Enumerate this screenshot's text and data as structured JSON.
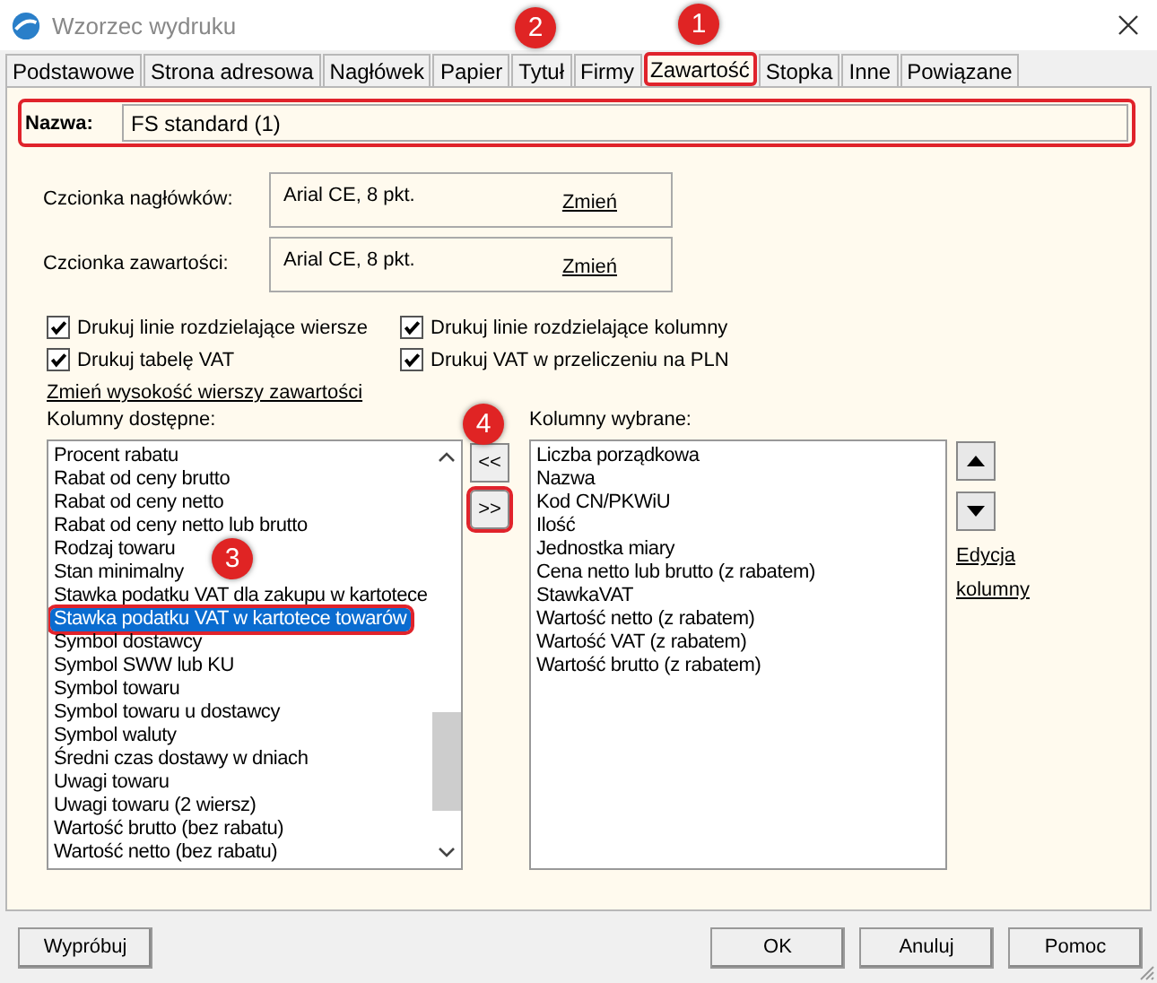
{
  "window": {
    "title": "Wzorzec wydruku"
  },
  "tabs": [
    {
      "label": "Podstawowe",
      "selected": false,
      "highlighted": false
    },
    {
      "label": "Strona adresowa",
      "selected": false,
      "highlighted": false
    },
    {
      "label": "Nagłówek",
      "selected": false,
      "highlighted": false
    },
    {
      "label": "Papier",
      "selected": false,
      "highlighted": false
    },
    {
      "label": "Tytuł",
      "selected": false,
      "highlighted": false
    },
    {
      "label": "Firmy",
      "selected": false,
      "highlighted": false
    },
    {
      "label": "Zawartość",
      "selected": true,
      "highlighted": true
    },
    {
      "label": "Stopka",
      "selected": false,
      "highlighted": false
    },
    {
      "label": "Inne",
      "selected": false,
      "highlighted": false
    },
    {
      "label": "Powiązane",
      "selected": false,
      "highlighted": false
    }
  ],
  "name_field": {
    "label": "Nazwa:",
    "value": "FS standard (1)",
    "highlighted": true
  },
  "fonts": [
    {
      "label": "Czcionka nagłówków:",
      "value": "Arial CE, 8 pkt.",
      "link": "Zmień"
    },
    {
      "label": "Czcionka zawartości:",
      "value": "Arial CE, 8 pkt.",
      "link": "Zmień"
    }
  ],
  "checkboxes": [
    {
      "label": "Drukuj linie rozdzielające wiersze",
      "checked": true
    },
    {
      "label": "Drukuj linie rozdzielające kolumny",
      "checked": true
    },
    {
      "label": "Drukuj tabelę VAT",
      "checked": true
    },
    {
      "label": "Drukuj VAT w przeliczeniu na PLN",
      "checked": true
    }
  ],
  "row_height_link": "Zmień wysokość wierszy zawartości",
  "available_columns": {
    "label": "Kolumny dostępne:",
    "items": [
      {
        "text": "Procent rabatu",
        "selected": false
      },
      {
        "text": "Rabat od ceny brutto",
        "selected": false
      },
      {
        "text": "Rabat od ceny netto",
        "selected": false
      },
      {
        "text": "Rabat od ceny netto lub brutto",
        "selected": false
      },
      {
        "text": "Rodzaj towaru",
        "selected": false
      },
      {
        "text": "Stan minimalny",
        "selected": false
      },
      {
        "text": "Stawka podatku VAT dla zakupu w kartotece",
        "selected": false
      },
      {
        "text": "Stawka podatku VAT w kartotece towarów",
        "selected": true
      },
      {
        "text": "Symbol dostawcy",
        "selected": false
      },
      {
        "text": "Symbol SWW lub KU",
        "selected": false
      },
      {
        "text": "Symbol towaru",
        "selected": false
      },
      {
        "text": "Symbol towaru u dostawcy",
        "selected": false
      },
      {
        "text": "Symbol waluty",
        "selected": false
      },
      {
        "text": "Średni czas dostawy w dniach",
        "selected": false
      },
      {
        "text": "Uwagi towaru",
        "selected": false
      },
      {
        "text": "Uwagi towaru (2 wiersz)",
        "selected": false
      },
      {
        "text": "Wartość brutto (bez rabatu)",
        "selected": false
      },
      {
        "text": "Wartość netto (bez rabatu)",
        "selected": false
      }
    ]
  },
  "move_buttons": [
    {
      "label": "<<",
      "highlighted": false
    },
    {
      "label": ">>",
      "highlighted": true
    }
  ],
  "selected_columns": {
    "label": "Kolumny wybrane:",
    "items": [
      {
        "text": "Liczba porządkowa",
        "selected": false
      },
      {
        "text": "Nazwa",
        "selected": false
      },
      {
        "text": "Kod CN/PKWiU",
        "selected": false
      },
      {
        "text": "Ilość",
        "selected": false
      },
      {
        "text": "Jednostka miary",
        "selected": false
      },
      {
        "text": "Cena netto lub brutto (z rabatem)",
        "selected": false
      },
      {
        "text": "StawkaVAT",
        "selected": false
      },
      {
        "text": "Wartość netto (z rabatem)",
        "selected": false
      },
      {
        "text": "Wartość VAT (z rabatem)",
        "selected": false
      },
      {
        "text": "Wartość brutto (z rabatem)",
        "selected": false
      }
    ]
  },
  "edit_links": [
    "Edycja",
    "kolumny"
  ],
  "footer_buttons": [
    "Wypróbuj",
    "OK",
    "Anuluj",
    "Pomoc"
  ],
  "callouts": [
    "1",
    "2",
    "3",
    "4"
  ]
}
